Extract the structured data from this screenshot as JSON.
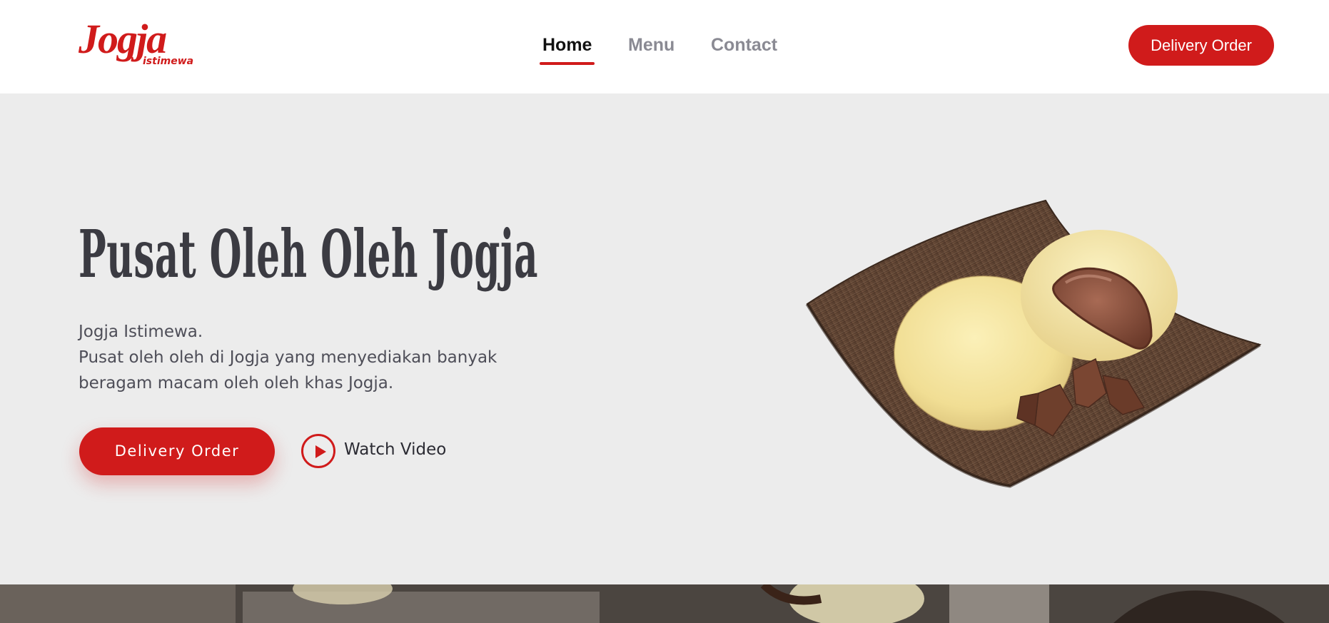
{
  "header": {
    "logo": {
      "main": "Jogja",
      "sub": "istimewa"
    },
    "nav": [
      {
        "label": "Home",
        "active": true
      },
      {
        "label": "Menu",
        "active": false
      },
      {
        "label": "Contact",
        "active": false
      }
    ],
    "cta_label": "Delivery Order"
  },
  "hero": {
    "title": "Pusat Oleh Oleh Jogja",
    "description": [
      "Jogja Istimewa.",
      "Pusat oleh oleh di Jogja yang menyediakan banyak",
      "beragam macam oleh oleh khas Jogja."
    ],
    "primary_button": "Delivery Order",
    "watch_video": {
      "label": "Watch Video",
      "icon": "play-icon"
    },
    "image": {
      "subject": "bakpia-on-wooden-plate"
    }
  },
  "colors": {
    "accent": "#d01b1b",
    "hero_bg": "#ececec",
    "header_bg": "#ffffff",
    "title": "#3b3b42",
    "nav_inactive": "#8a8a93"
  }
}
